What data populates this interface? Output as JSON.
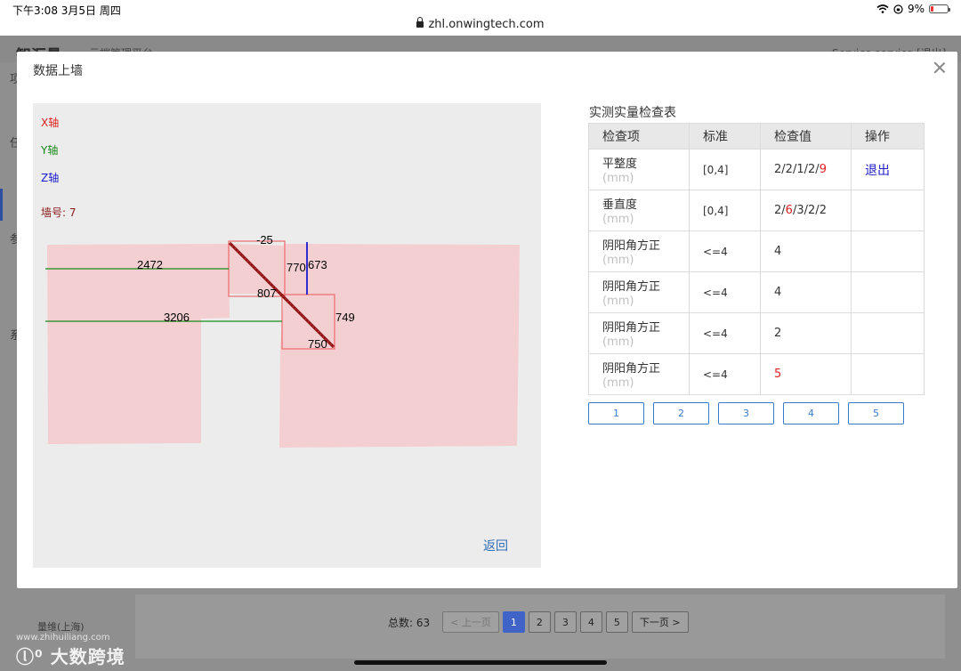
{
  "status_bar": {
    "time_date": "下午3:08   3月5日 周四",
    "url": "zhl.onwingtech.com",
    "battery": "9%"
  },
  "background": {
    "logo": "智汇量",
    "subtitle": "云端管理平台",
    "user": "Service  service  [退出]",
    "side_items": [
      "项",
      "任",
      "参",
      "系"
    ],
    "footer": "量维(上海)",
    "pagination": {
      "total": "总数: 63",
      "prev": "< 上一页",
      "pages": [
        "1",
        "2",
        "3",
        "4",
        "5"
      ],
      "active": "1",
      "next": "下一页 >"
    }
  },
  "watermark": {
    "url": "www.zhihuiliang.com",
    "text": "大数跨境"
  },
  "modal": {
    "title": "数据上墙",
    "back_label": "返回",
    "axes": {
      "x": "X轴",
      "y": "Y轴",
      "z": "Z轴",
      "wall_no": "墙号: 7"
    },
    "drawing_labels": [
      "-25",
      "2472",
      "770",
      "673",
      "807",
      "3206",
      "749",
      "750"
    ],
    "colors": {
      "x_axis": "#e02020",
      "y_axis": "#1a8a1a",
      "z_axis": "#1a1ad0",
      "wall_no": "#8b1a1a",
      "wall_fill": "#f3cfd1",
      "diagonal": "#8b1010"
    },
    "table": {
      "title": "实测实量检查表",
      "headers": [
        "检查项",
        "标准",
        "检查值",
        "操作"
      ],
      "unit": "(mm)",
      "rows": [
        {
          "item": "平整度",
          "standard": "[0,4]",
          "values": [
            [
              "2",
              false
            ],
            [
              "2",
              false
            ],
            [
              "1",
              false
            ],
            [
              "2",
              false
            ],
            [
              "9",
              true
            ]
          ],
          "action": "退出"
        },
        {
          "item": "垂直度",
          "standard": "[0,4]",
          "values": [
            [
              "2",
              false
            ],
            [
              "6",
              true
            ],
            [
              "3",
              false
            ],
            [
              "2",
              false
            ],
            [
              "2",
              false
            ]
          ],
          "action": ""
        },
        {
          "item": "阴阳角方正",
          "standard": "<=4",
          "values": [
            [
              "4",
              false
            ]
          ],
          "action": ""
        },
        {
          "item": "阴阳角方正",
          "standard": "<=4",
          "values": [
            [
              "4",
              false
            ]
          ],
          "action": ""
        },
        {
          "item": "阴阳角方正",
          "standard": "<=4",
          "values": [
            [
              "2",
              false
            ]
          ],
          "action": ""
        },
        {
          "item": "阴阳角方正",
          "standard": "<=4",
          "values": [
            [
              "5",
              true
            ]
          ],
          "action": ""
        }
      ]
    },
    "page_tabs": [
      "1",
      "2",
      "3",
      "4",
      "5"
    ]
  }
}
